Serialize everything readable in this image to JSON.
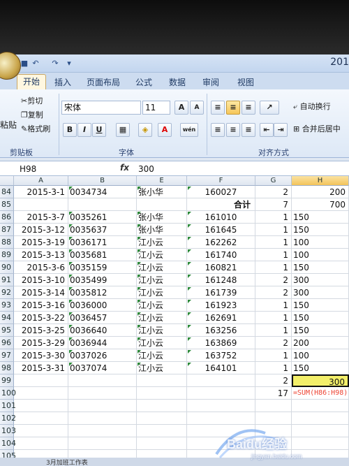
{
  "title": "201",
  "ribbon": {
    "tabs": [
      "开始",
      "插入",
      "页面布局",
      "公式",
      "数据",
      "审阅",
      "视图"
    ],
    "clipboard": {
      "cut": "剪切",
      "copy": "复制",
      "paste": "粘贴",
      "format_painter": "格式刷",
      "group": "剪贴板"
    },
    "font": {
      "name": "宋体",
      "size": "11",
      "group": "字体",
      "bold": "B",
      "italic": "I",
      "underline": "U",
      "grow": "A",
      "shrink": "A"
    },
    "alignment": {
      "wrap": "自动换行",
      "merge": "合并后居中",
      "group": "对齐方式"
    }
  },
  "formula_bar": {
    "name_box": "H98",
    "fx": "fx",
    "content": "300"
  },
  "columns": [
    "A",
    "B",
    "E",
    "F",
    "G",
    "H"
  ],
  "rows": [
    {
      "n": "84",
      "a": "2015-3-1",
      "b": "0034734",
      "e": "张小华",
      "f": "160027",
      "g": "2",
      "h": "200"
    },
    {
      "n": "85",
      "a": "",
      "b": "",
      "e": "",
      "f": "合计",
      "g": "7",
      "h": "700"
    },
    {
      "n": "86",
      "a": "2015-3-7",
      "b": "0035261",
      "e": "张小华",
      "f": "161010",
      "g": "1",
      "h": "150"
    },
    {
      "n": "87",
      "a": "2015-3-12",
      "b": "0035637",
      "e": "张小华",
      "f": "161645",
      "g": "1",
      "h": "150"
    },
    {
      "n": "88",
      "a": "2015-3-19",
      "b": "0036171",
      "e": "江小云",
      "f": "162262",
      "g": "1",
      "h": "100"
    },
    {
      "n": "89",
      "a": "2015-3-13",
      "b": "0035681",
      "e": "江小云",
      "f": "161740",
      "g": "1",
      "h": "100"
    },
    {
      "n": "90",
      "a": "2015-3-6",
      "b": "0035159",
      "e": "江小云",
      "f": "160821",
      "g": "1",
      "h": "150"
    },
    {
      "n": "91",
      "a": "2015-3-10",
      "b": "0035499",
      "e": "江小云",
      "f": "161248",
      "g": "2",
      "h": "300"
    },
    {
      "n": "92",
      "a": "2015-3-14",
      "b": "0035812",
      "e": "江小云",
      "f": "161739",
      "g": "2",
      "h": "300"
    },
    {
      "n": "93",
      "a": "2015-3-16",
      "b": "0036000",
      "e": "江小云",
      "f": "161923",
      "g": "1",
      "h": "150"
    },
    {
      "n": "94",
      "a": "2015-3-22",
      "b": "0036457",
      "e": "江小云",
      "f": "162691",
      "g": "1",
      "h": "150"
    },
    {
      "n": "95",
      "a": "2015-3-25",
      "b": "0036640",
      "e": "江小云",
      "f": "163256",
      "g": "1",
      "h": "150"
    },
    {
      "n": "96",
      "a": "2015-3-29",
      "b": "0036944",
      "e": "江小云",
      "f": "163869",
      "g": "2",
      "h": "200"
    },
    {
      "n": "97",
      "a": "2015-3-30",
      "b": "0037026",
      "e": "江小云",
      "f": "163752",
      "g": "1",
      "h": "100"
    },
    {
      "n": "98",
      "a": "2015-3-31",
      "b": "0037074",
      "e": "江小云",
      "f": "164101",
      "g": "1",
      "h": "150"
    },
    {
      "n": "99",
      "a": "",
      "b": "",
      "e": "",
      "f": "",
      "g": "2",
      "h": "300"
    },
    {
      "n": "100",
      "a": "",
      "b": "",
      "e": "",
      "f": "",
      "g": "17",
      "h": "=SUM(H86:H98)"
    },
    {
      "n": "101",
      "a": "",
      "b": "",
      "e": "",
      "f": "",
      "g": "",
      "h": ""
    },
    {
      "n": "102",
      "a": "",
      "b": "",
      "e": "",
      "f": "",
      "g": "",
      "h": ""
    },
    {
      "n": "103",
      "a": "",
      "b": "",
      "e": "",
      "f": "",
      "g": "",
      "h": ""
    },
    {
      "n": "104",
      "a": "",
      "b": "",
      "e": "",
      "f": "",
      "g": "",
      "h": ""
    },
    {
      "n": "105",
      "a": "",
      "b": "",
      "e": "",
      "f": "",
      "g": "",
      "h": ""
    },
    {
      "n": "106",
      "a": "",
      "b": "",
      "e": "",
      "f": "",
      "g": "",
      "h": ""
    }
  ],
  "sheet_tab": "3月加班工作表",
  "watermark": {
    "text": "Baidu经验",
    "url": "jingyan.baidu.com"
  }
}
